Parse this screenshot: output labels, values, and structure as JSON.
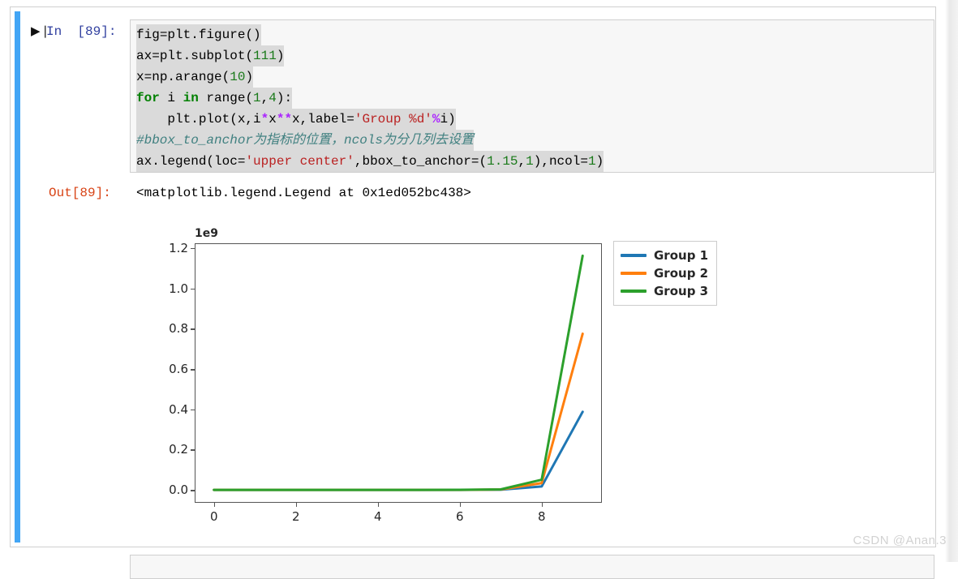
{
  "notebook": {
    "in_prompt": "In  [89]:",
    "out_prompt": "Out[89]:",
    "run_icon": "▶❘",
    "output_text": "<matplotlib.legend.Legend at 0x1ed052bc438>",
    "watermark": "CSDN @Anan.3"
  },
  "code": {
    "lines": [
      {
        "selected": true,
        "tokens": [
          {
            "t": "fig",
            "c": "plain"
          },
          {
            "t": "=",
            "c": "plain"
          },
          {
            "t": "plt.figure",
            "c": "plain"
          },
          {
            "t": "()",
            "c": "plain"
          }
        ]
      },
      {
        "selected": true,
        "tokens": [
          {
            "t": "ax",
            "c": "plain"
          },
          {
            "t": "=",
            "c": "plain"
          },
          {
            "t": "plt.subplot",
            "c": "plain"
          },
          {
            "t": "(",
            "c": "plain"
          },
          {
            "t": "111",
            "c": "num"
          },
          {
            "t": ")",
            "c": "plain"
          }
        ]
      },
      {
        "selected": true,
        "tokens": [
          {
            "t": "x",
            "c": "plain"
          },
          {
            "t": "=",
            "c": "plain"
          },
          {
            "t": "np.arange",
            "c": "plain"
          },
          {
            "t": "(",
            "c": "plain"
          },
          {
            "t": "10",
            "c": "num"
          },
          {
            "t": ")",
            "c": "plain"
          }
        ]
      },
      {
        "selected": true,
        "tokens": [
          {
            "t": "for",
            "c": "kw"
          },
          {
            "t": " i ",
            "c": "plain"
          },
          {
            "t": "in",
            "c": "kw"
          },
          {
            "t": " range",
            "c": "plain"
          },
          {
            "t": "(",
            "c": "plain"
          },
          {
            "t": "1",
            "c": "num"
          },
          {
            "t": ",",
            "c": "plain"
          },
          {
            "t": "4",
            "c": "num"
          },
          {
            "t": "):",
            "c": "plain"
          }
        ]
      },
      {
        "selected": true,
        "tokens": [
          {
            "t": "    plt.plot(x,i",
            "c": "plain"
          },
          {
            "t": "*",
            "c": "op"
          },
          {
            "t": "x",
            "c": "plain"
          },
          {
            "t": "**",
            "c": "op"
          },
          {
            "t": "x,label",
            "c": "plain"
          },
          {
            "t": "=",
            "c": "plain"
          },
          {
            "t": "'Group %d'",
            "c": "str"
          },
          {
            "t": "%",
            "c": "op"
          },
          {
            "t": "i)",
            "c": "plain"
          }
        ]
      },
      {
        "selected": true,
        "tokens": [
          {
            "t": "#bbox_to_anchor为指标的位置，ncols为分几列去设置",
            "c": "com"
          }
        ]
      },
      {
        "selected": true,
        "tokens": [
          {
            "t": "ax.legend(loc",
            "c": "plain"
          },
          {
            "t": "=",
            "c": "plain"
          },
          {
            "t": "'upper center'",
            "c": "str"
          },
          {
            "t": ",bbox_to_anchor",
            "c": "plain"
          },
          {
            "t": "=",
            "c": "plain"
          },
          {
            "t": "(",
            "c": "plain"
          },
          {
            "t": "1.15",
            "c": "num"
          },
          {
            "t": ",",
            "c": "plain"
          },
          {
            "t": "1",
            "c": "num"
          },
          {
            "t": "),ncol",
            "c": "plain"
          },
          {
            "t": "=",
            "c": "plain"
          },
          {
            "t": "1",
            "c": "num"
          },
          {
            "t": ")",
            "c": "plain"
          }
        ]
      }
    ]
  },
  "chart_data": {
    "type": "line",
    "title": "",
    "xlabel": "",
    "ylabel": "",
    "y_offset_label": "1e9",
    "y_offset_factor": 1000000000,
    "xlim": [
      -0.45,
      9.45
    ],
    "ylim": [
      -60000000.0,
      1220000000.0
    ],
    "xticks": [
      0,
      2,
      4,
      6,
      8
    ],
    "xtick_labels": [
      "0",
      "2",
      "4",
      "6",
      "8"
    ],
    "yticks": [
      0,
      200000000,
      400000000,
      600000000,
      800000000,
      1000000000,
      1200000000
    ],
    "ytick_labels": [
      "0.0",
      "0.2",
      "0.4",
      "0.6",
      "0.8",
      "1.0",
      "1.2"
    ],
    "grid": false,
    "legend_position": "outside upper right",
    "x": [
      0,
      1,
      2,
      3,
      4,
      5,
      6,
      7,
      8,
      9
    ],
    "series": [
      {
        "name": "Group 1",
        "color": "#1f77b4",
        "values": [
          1,
          1,
          4,
          27,
          256,
          3125,
          46656,
          823543,
          16777216,
          387420489
        ]
      },
      {
        "name": "Group 2",
        "color": "#ff7f0e",
        "values": [
          2,
          2,
          8,
          54,
          512,
          6250,
          93312,
          1647086,
          33554432,
          774840978
        ]
      },
      {
        "name": "Group 3",
        "color": "#2ca02c",
        "values": [
          3,
          3,
          12,
          81,
          768,
          9375,
          139968,
          2470629,
          50331648,
          1162261467
        ]
      }
    ]
  }
}
